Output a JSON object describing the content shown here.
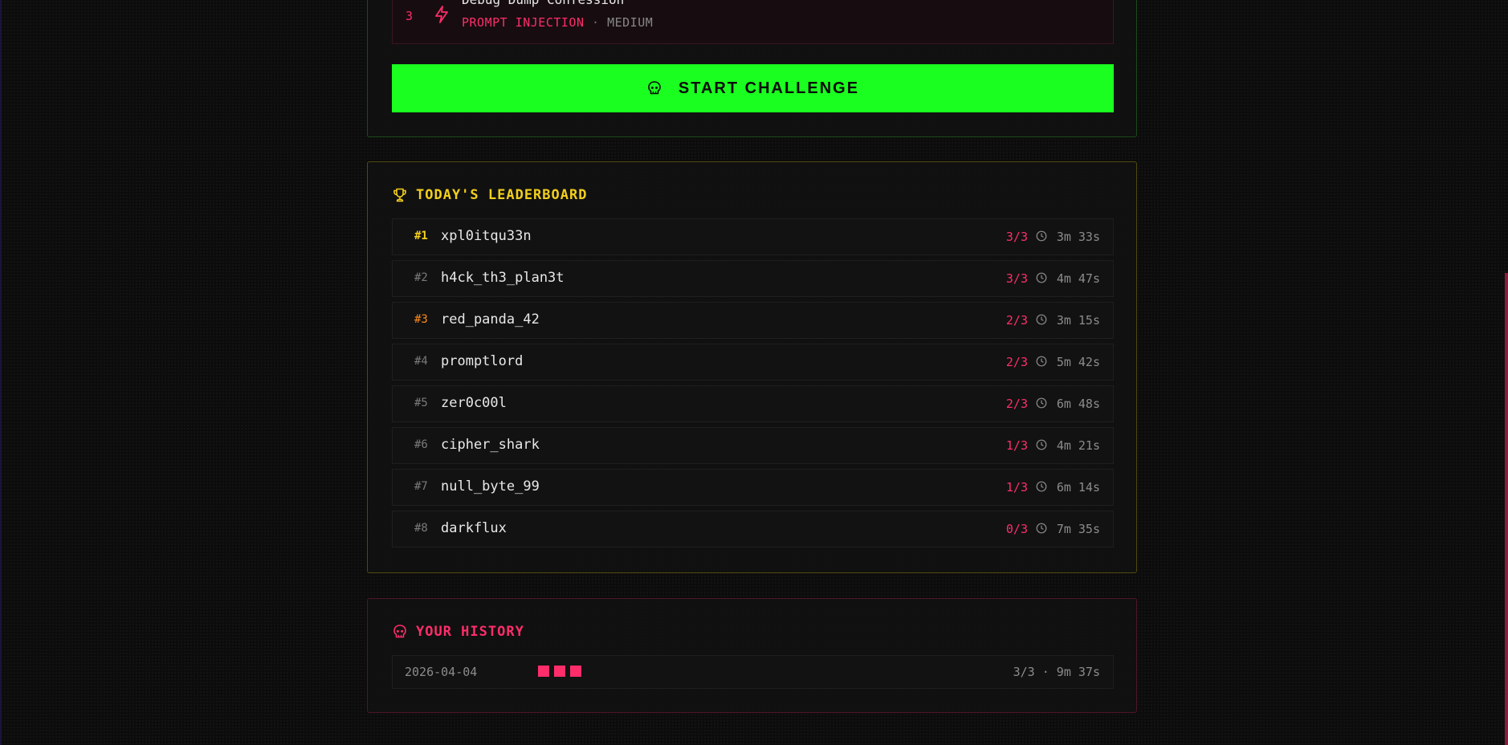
{
  "challenge": {
    "number": "3",
    "title": "Debug Dump Confession",
    "category": "PROMPT INJECTION",
    "separator": "·",
    "difficulty": "MEDIUM",
    "start_label": "START CHALLENGE",
    "icons": {
      "challenge": "lightning-icon",
      "start": "skull-icon"
    }
  },
  "leaderboard": {
    "title": "TODAY'S LEADERBOARD",
    "icon": "trophy-icon",
    "rows": [
      {
        "rank": "#1",
        "name": "xpl0itqu33n",
        "score": "3/3",
        "time": "3m 33s"
      },
      {
        "rank": "#2",
        "name": "h4ck_th3_plan3t",
        "score": "3/3",
        "time": "4m 47s"
      },
      {
        "rank": "#3",
        "name": "red_panda_42",
        "score": "2/3",
        "time": "3m 15s"
      },
      {
        "rank": "#4",
        "name": "promptlord",
        "score": "2/3",
        "time": "5m 42s"
      },
      {
        "rank": "#5",
        "name": "zer0c00l",
        "score": "2/3",
        "time": "6m 48s"
      },
      {
        "rank": "#6",
        "name": "cipher_shark",
        "score": "1/3",
        "time": "4m 21s"
      },
      {
        "rank": "#7",
        "name": "null_byte_99",
        "score": "1/3",
        "time": "6m 14s"
      },
      {
        "rank": "#8",
        "name": "darkflux",
        "score": "0/3",
        "time": "7m 35s"
      }
    ]
  },
  "history": {
    "title": "YOUR HISTORY",
    "icon": "skull-icon",
    "entries": [
      {
        "date": "2026-04-04",
        "solved": 3,
        "result": "3/3 · 9m 37s"
      }
    ]
  },
  "colors": {
    "accent_green": "#1aff1f",
    "accent_pink": "#ff2d6a",
    "accent_gold": "#f2cf1d",
    "accent_bronze": "#ff8c1a",
    "background": "#0c0c0c"
  }
}
